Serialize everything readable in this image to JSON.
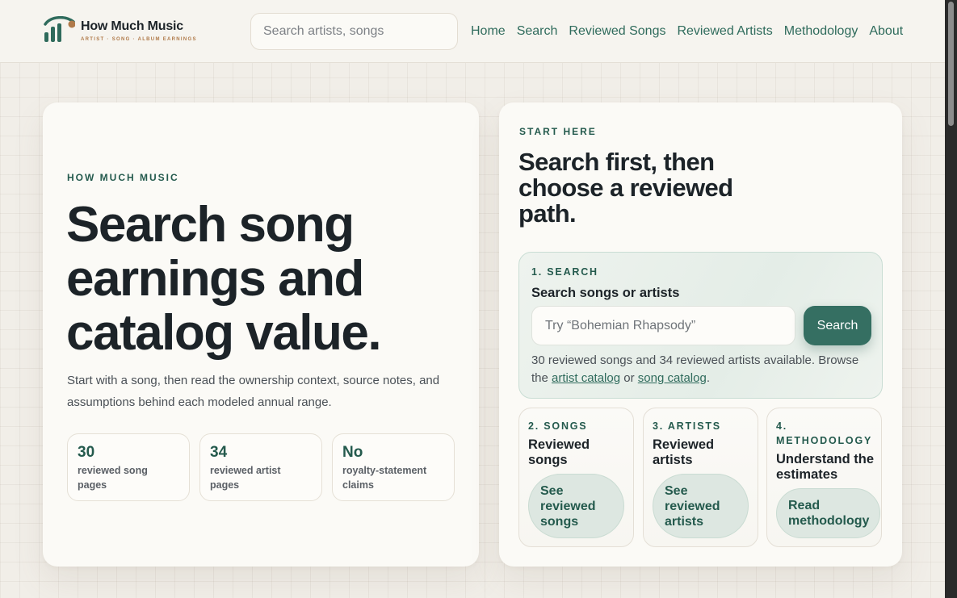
{
  "header": {
    "brand": "How Much Music",
    "tagline": "ARTIST · SONG · ALBUM EARNINGS",
    "search_placeholder": "Search artists, songs",
    "nav": [
      "Home",
      "Search",
      "Reviewed Songs",
      "Reviewed Artists",
      "Methodology",
      "About"
    ]
  },
  "hero": {
    "eyebrow": "HOW MUCH MUSIC",
    "title": "Search song earnings and catalog value.",
    "subtitle": "Start with a song, then read the ownership context, source notes, and assumptions behind each modeled annual range.",
    "stats": [
      {
        "value": "30",
        "label": "reviewed song pages"
      },
      {
        "value": "34",
        "label": "reviewed artist pages"
      },
      {
        "value": "No",
        "label": "royalty-statement claims"
      }
    ]
  },
  "start": {
    "eyebrow": "START HERE",
    "title": "Search first, then choose a reviewed path.",
    "search_panel": {
      "step": "1. SEARCH",
      "title": "Search songs or artists",
      "placeholder": "Try “Bohemian Rhapsody”",
      "button": "Search",
      "note_text": "30 reviewed songs and 34 reviewed artists available. Browse the",
      "link_artist": "artist catalog",
      "note_or": "or",
      "link_song": "song catalog",
      "note_end": "."
    },
    "steps": [
      {
        "label": "2. SONGS",
        "title": "Reviewed songs",
        "button": "See reviewed songs"
      },
      {
        "label": "3. ARTISTS",
        "title": "Reviewed artists",
        "button": "See reviewed artists"
      },
      {
        "label": "4. METHODOLOGY",
        "title": "Understand the estimates",
        "button": "Read methodology"
      }
    ]
  },
  "colors": {
    "accent": "#245a4d",
    "button": "#356f62",
    "brand_tagline": "#b07a4a",
    "background": "#f1eee8"
  },
  "icons": {
    "logo": "bar-chart-music-icon"
  }
}
